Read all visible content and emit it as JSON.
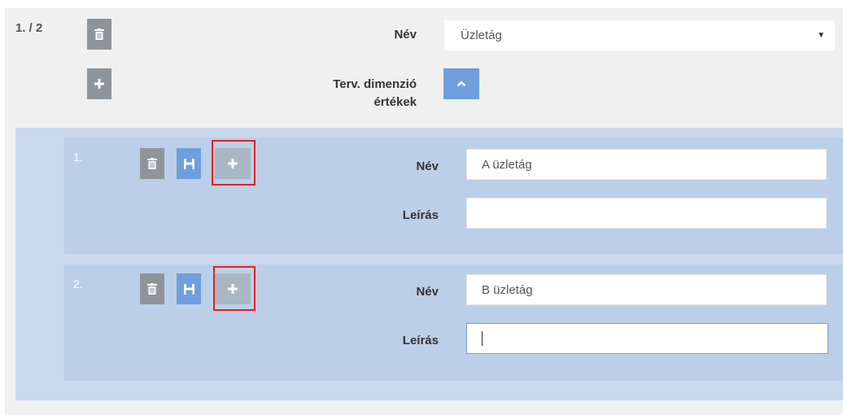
{
  "header": {
    "index": "1. / 2",
    "name_label": "Név",
    "name_value": "Üzletág",
    "dim_label_line1": "Terv. dimenzió",
    "dim_label_line2": "értékek"
  },
  "items": [
    {
      "index": "1.",
      "name_label": "Név",
      "name_value": "A üzletág",
      "desc_label": "Leírás",
      "desc_value": ""
    },
    {
      "index": "2.",
      "name_label": "Név",
      "name_value": "B üzletág",
      "desc_label": "Leírás",
      "desc_value": ""
    }
  ],
  "icons": {
    "delete": "trash-icon",
    "save": "save-icon",
    "add": "plus-icon",
    "collapse": "chevron-up-icon",
    "dropdown": "caret-down-icon"
  },
  "colors": {
    "blue_button": "#6e9fdc",
    "gray_button": "#8e959a",
    "highlight": "#e02020"
  }
}
